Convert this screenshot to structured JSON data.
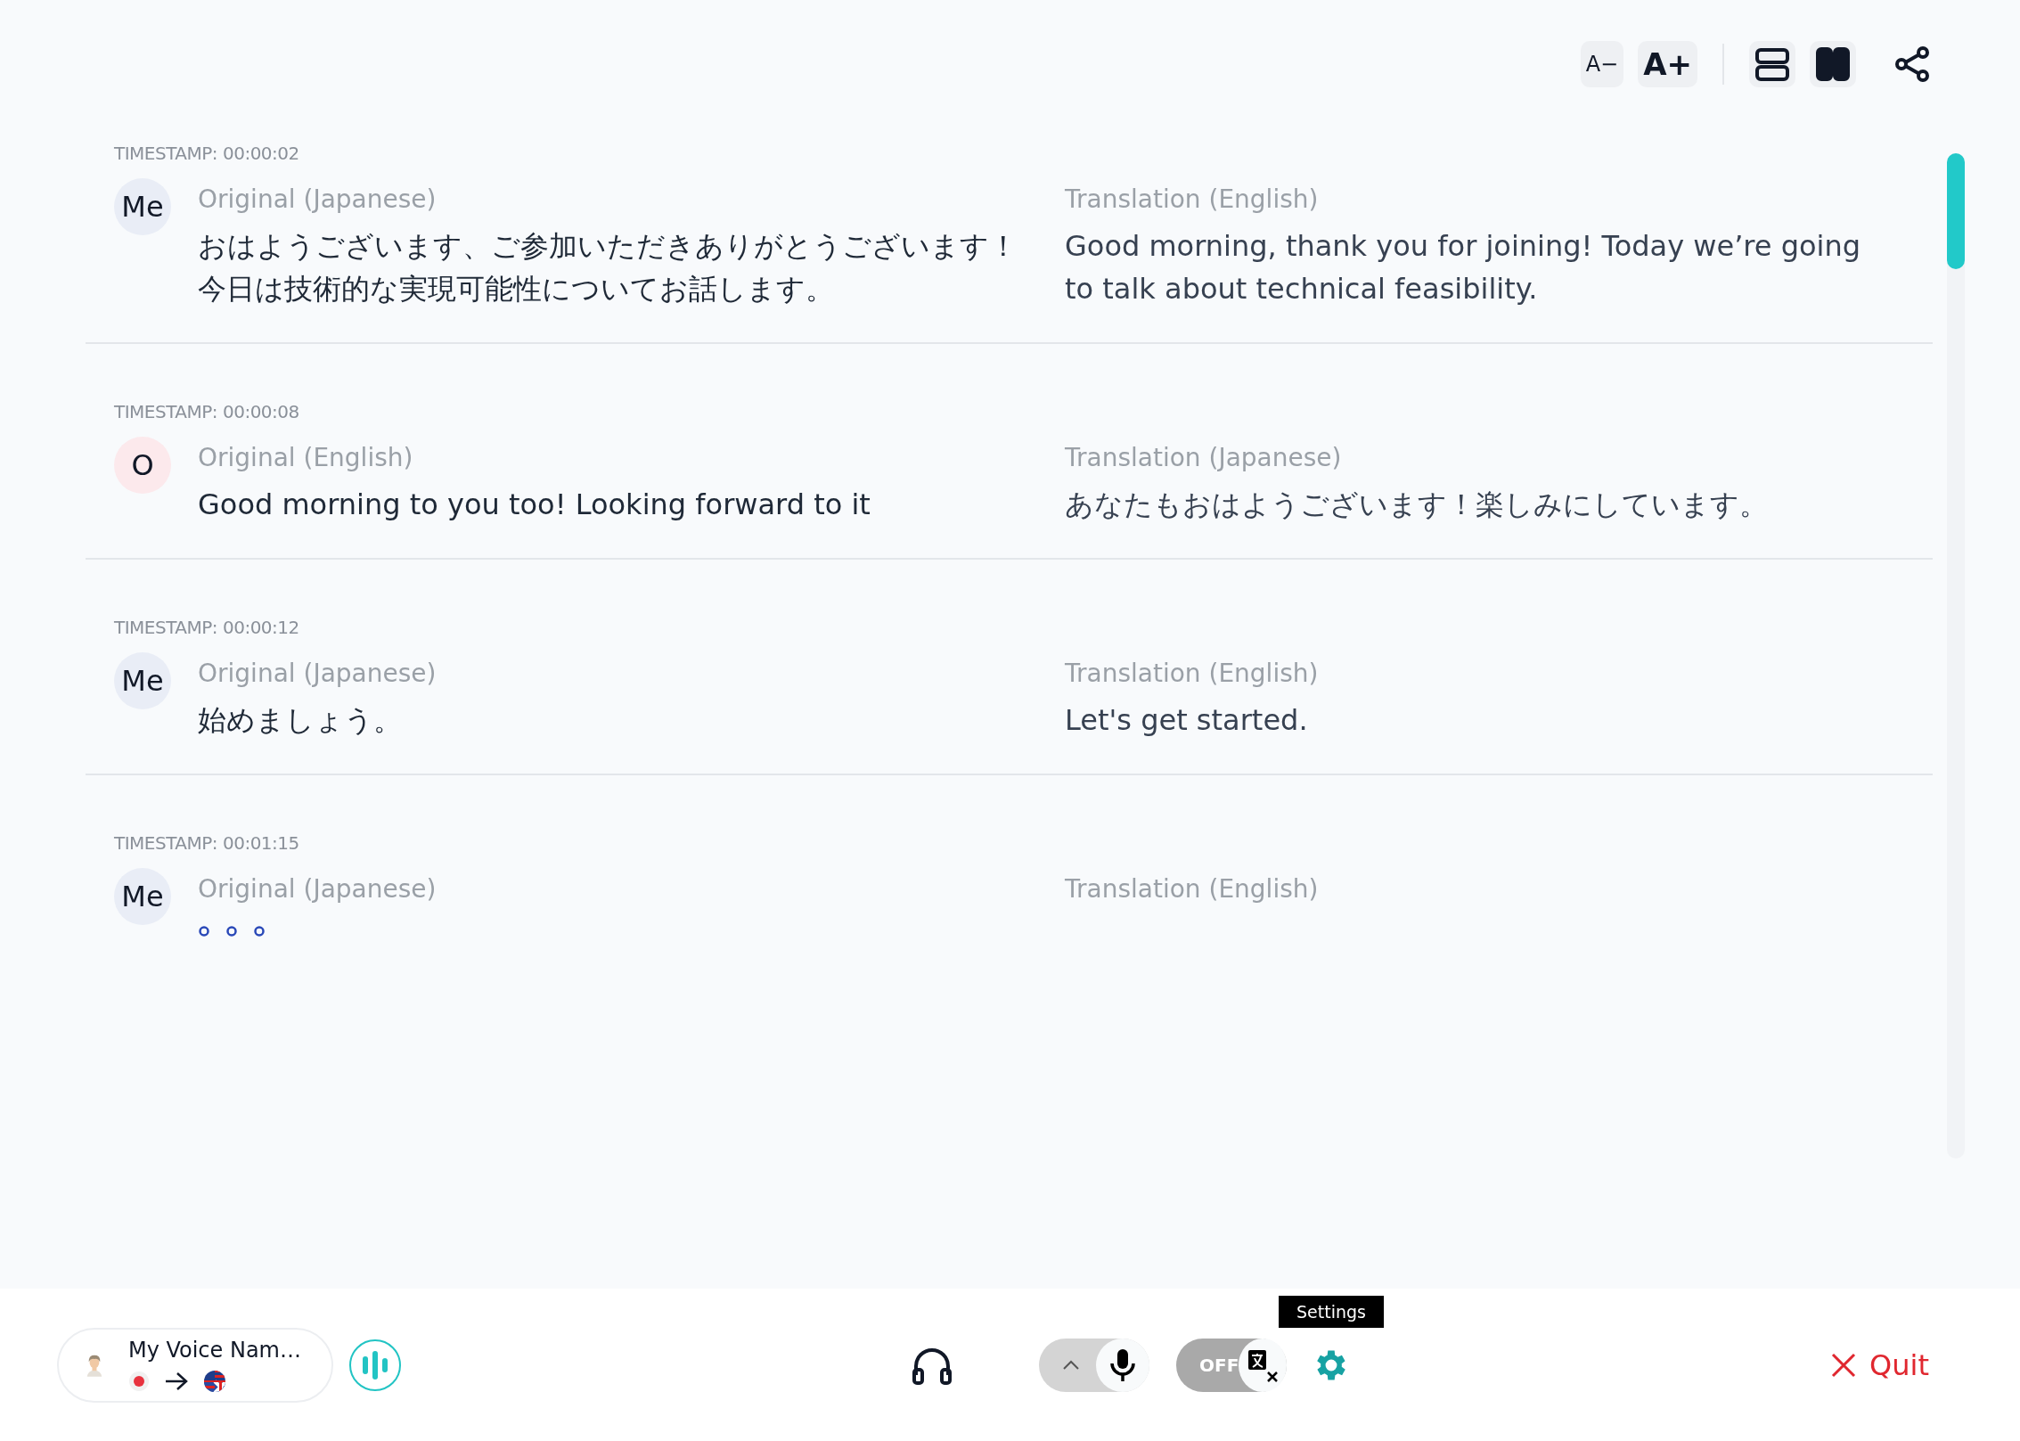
{
  "toolbar": {
    "font_smaller": "A−",
    "font_larger": "A+",
    "layout_buttons": [
      {
        "kind": "rows",
        "selected": false
      },
      {
        "kind": "columns",
        "selected": true
      }
    ]
  },
  "entries": [
    {
      "timestamp": "TIMESTAMP: 00:00:02",
      "speaker": "Me",
      "color": "#e9edf6",
      "original_label": "Original (Japanese)",
      "original_text": "おはようございます、ご参加いただきありがとうございます！今日は技術的な実現可能性についてお話します。",
      "translation_label": "Translation (English)",
      "translation_text": "Good morning, thank you for joining! Today we’re going to talk about technical feasibility.",
      "typing": false
    },
    {
      "timestamp": "TIMESTAMP: 00:00:08",
      "speaker": "O",
      "color": "#fce9ec",
      "original_label": "Original (English)",
      "original_text": "Good morning to you too! Looking forward to it",
      "translation_label": "Translation (Japanese)",
      "translation_text": "あなたもおはようございます！楽しみにしています。",
      "typing": false
    },
    {
      "timestamp": "TIMESTAMP: 00:00:12",
      "speaker": "Me",
      "color": "#e9edf6",
      "original_label": "Original (Japanese)",
      "original_text": "始めましょう。",
      "translation_label": "Translation (English)",
      "translation_text": "Let's get started.",
      "typing": false
    },
    {
      "timestamp": "TIMESTAMP: 00:01:15",
      "speaker": "Me",
      "color": "#e9edf6",
      "original_label": "Original (Japanese)",
      "translation_label": "Translation (English)",
      "typing": true
    }
  ],
  "bottom_bar": {
    "voice_name": "My Voice Nam…",
    "microphone_toggle": {
      "on": true
    },
    "translation_toggle": {
      "label": "OFF",
      "on": false
    },
    "tooltip": "Settings",
    "quit": "Quit"
  }
}
